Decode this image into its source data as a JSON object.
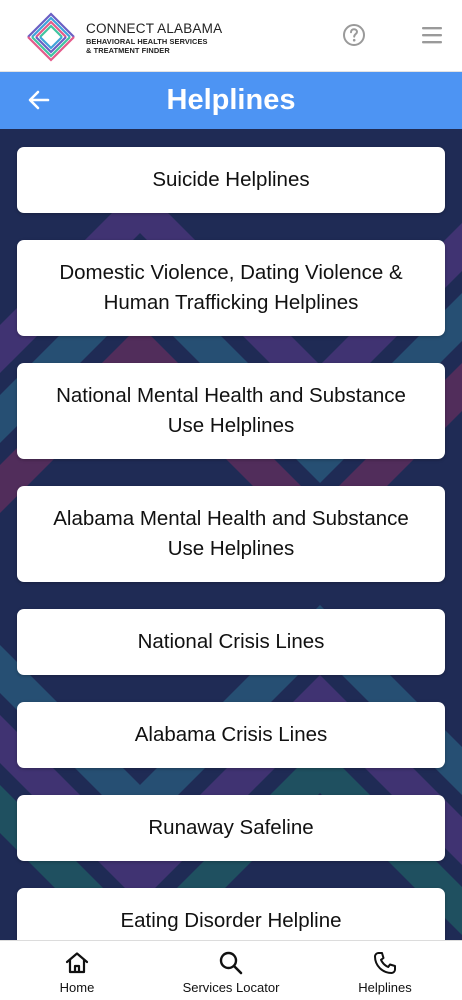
{
  "header": {
    "logo_title": "CONNECT ALABAMA",
    "logo_sub_1": "BEHAVIORAL HEALTH SERVICES",
    "logo_sub_2": "& TREATMENT FINDER",
    "help_icon": "question-circle-icon",
    "menu_icon": "hamburger-icon"
  },
  "titlebar": {
    "title": "Helplines",
    "back_icon": "arrow-left-icon",
    "color": "#4d94f3"
  },
  "helplines": [
    {
      "label": "Suicide Helplines"
    },
    {
      "label": "Domestic Violence, Dating Violence & Human Trafficking Helplines"
    },
    {
      "label": "National Mental Health and Substance Use Helplines"
    },
    {
      "label": "Alabama Mental Health and Substance Use Helplines"
    },
    {
      "label": "National Crisis Lines"
    },
    {
      "label": "Alabama Crisis Lines"
    },
    {
      "label": "Runaway Safeline"
    },
    {
      "label": "Eating Disorder Helpline"
    }
  ],
  "bottom_nav": {
    "items": [
      {
        "label": "Home",
        "icon": "home-icon"
      },
      {
        "label": "Services Locator",
        "icon": "search-icon"
      },
      {
        "label": "Helplines",
        "icon": "phone-icon"
      }
    ]
  },
  "colors": {
    "background": "#1f2b55",
    "card": "#ffffff",
    "accent": "#4d94f3"
  }
}
